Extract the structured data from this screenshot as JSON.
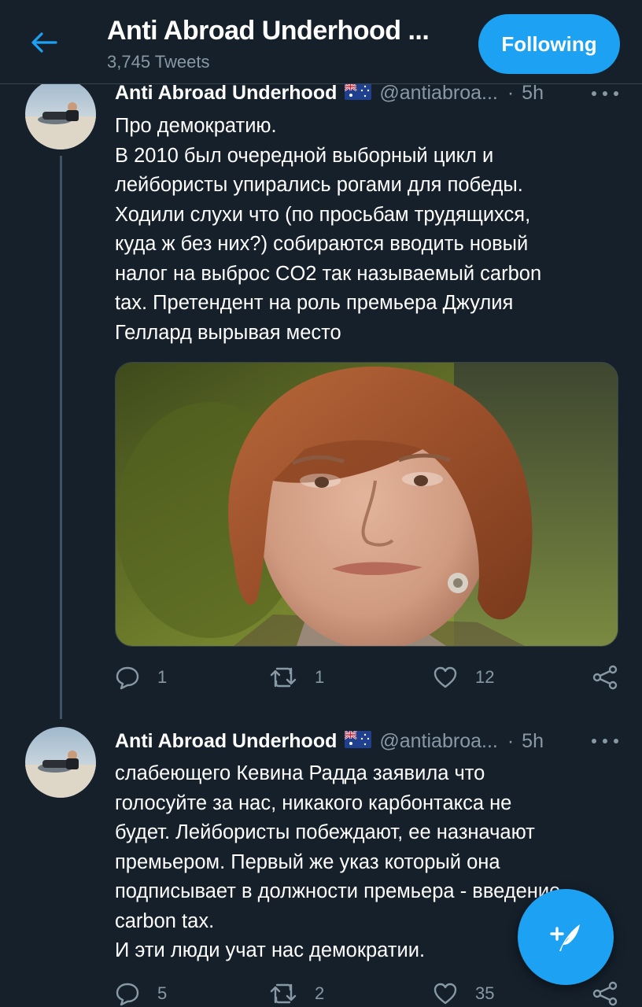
{
  "header": {
    "title": "Anti Abroad Underhood ...",
    "tweets_count": "3,745 Tweets",
    "follow_label": "Following"
  },
  "tweets": [
    {
      "author_name": "Anti Abroad Underhood",
      "flag_icon": "australia-flag-icon",
      "handle": "@antiabroa...",
      "separator": "·",
      "time": "5h",
      "lines": [
        "Про демократию.",
        "В 2010 был очередной выборный цикл и",
        "лейбористы упирались рогами для победы.",
        "Ходили слухи что (по просьбам трудящихся,",
        "куда ж без них?) собираются вводить новый",
        "налог на выброс CO2 так называемый carbon",
        "tax. Претендент на роль премьера Джулия",
        "Геллард вырывая место"
      ],
      "replies": "1",
      "retweets": "1",
      "likes": "12"
    },
    {
      "author_name": "Anti Abroad Underhood",
      "flag_icon": "australia-flag-icon",
      "handle": "@antiabroa...",
      "separator": "·",
      "time": "5h",
      "lines": [
        "слабеющего Кевина Радда заявила что",
        "голосуйте за нас, никакого карбонтакса не",
        "будет. Лейбористы побеждают, ее назначают",
        "премьером. Первый же указ который она",
        "подписывает в должности премьера - введение",
        "carbon tax.",
        "И эти люди учат нас демократии."
      ],
      "replies": "5",
      "retweets": "2",
      "likes": "35"
    }
  ],
  "icons": {
    "back": "back-arrow-icon",
    "more": "more-dots-icon",
    "reply": "reply-icon",
    "retweet": "retweet-icon",
    "like": "heart-icon",
    "share": "share-icon",
    "compose": "compose-tweet-icon"
  },
  "colors": {
    "background": "#15202b",
    "accent": "#1da1f2",
    "secondary_text": "#8899a6",
    "divider": "#38444d"
  }
}
